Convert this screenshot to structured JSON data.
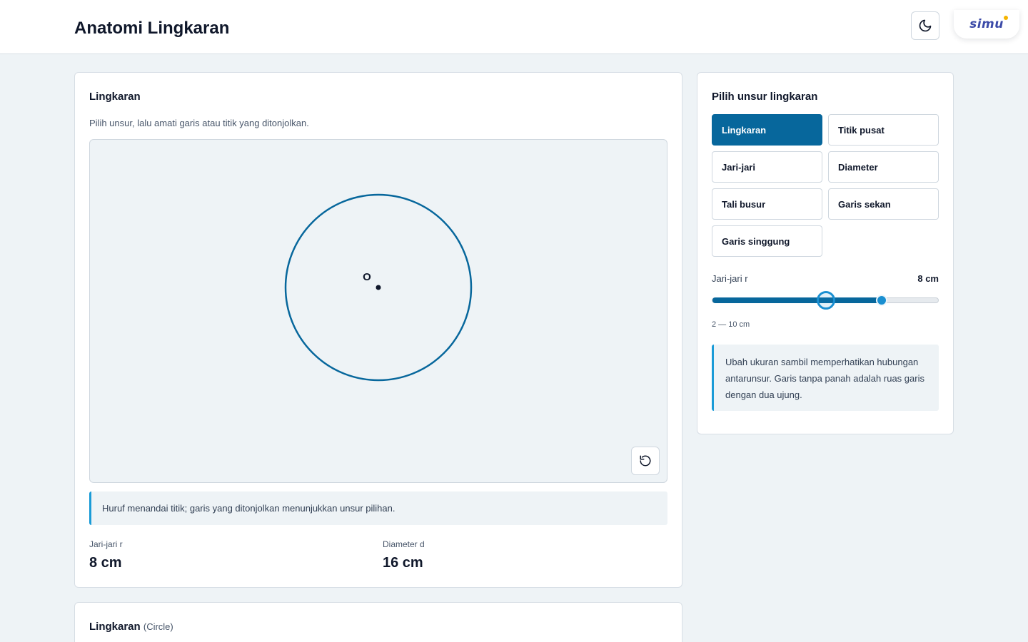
{
  "header": {
    "title": "Anatomi Lingkaran",
    "logo_text": "simu"
  },
  "main_card": {
    "title": "Lingkaran",
    "subtitle": "Pilih unsur, lalu amati garis atau titik yang ditonjolkan.",
    "canvas": {
      "center_label": "O",
      "radius_cm": 8,
      "stroke_color": "#07679c"
    },
    "note": "Huruf menandai titik; garis yang ditonjolkan menunjukkan unsur pilihan.",
    "stats": [
      {
        "label": "Jari-jari r",
        "value": "8 cm"
      },
      {
        "label": "Diameter d",
        "value": "16 cm"
      }
    ]
  },
  "side_card": {
    "title": "Pilih unsur lingkaran",
    "options": [
      {
        "label": "Lingkaran",
        "active": true
      },
      {
        "label": "Titik pusat",
        "active": false
      },
      {
        "label": "Jari-jari",
        "active": false
      },
      {
        "label": "Diameter",
        "active": false
      },
      {
        "label": "Tali busur",
        "active": false
      },
      {
        "label": "Garis sekan",
        "active": false
      },
      {
        "label": "Garis singgung",
        "active": false
      }
    ],
    "slider": {
      "label": "Jari-jari r",
      "value_text": "8 cm",
      "value": 8,
      "min": 2,
      "max": 10,
      "range_text": "2 — 10 cm"
    },
    "note": "Ubah ukuran sambil memperhatikan hubungan antarunsur. Garis tanpa panah adalah ruas garis dengan dua ujung."
  },
  "bottom_card": {
    "title": "Lingkaran",
    "subtitle": "(Circle)"
  },
  "colors": {
    "accent": "#07679c",
    "accent_light": "#1a9bd7",
    "background": "#eef3f6"
  },
  "icons": {
    "theme": "moon-icon",
    "reset": "reset-icon"
  }
}
